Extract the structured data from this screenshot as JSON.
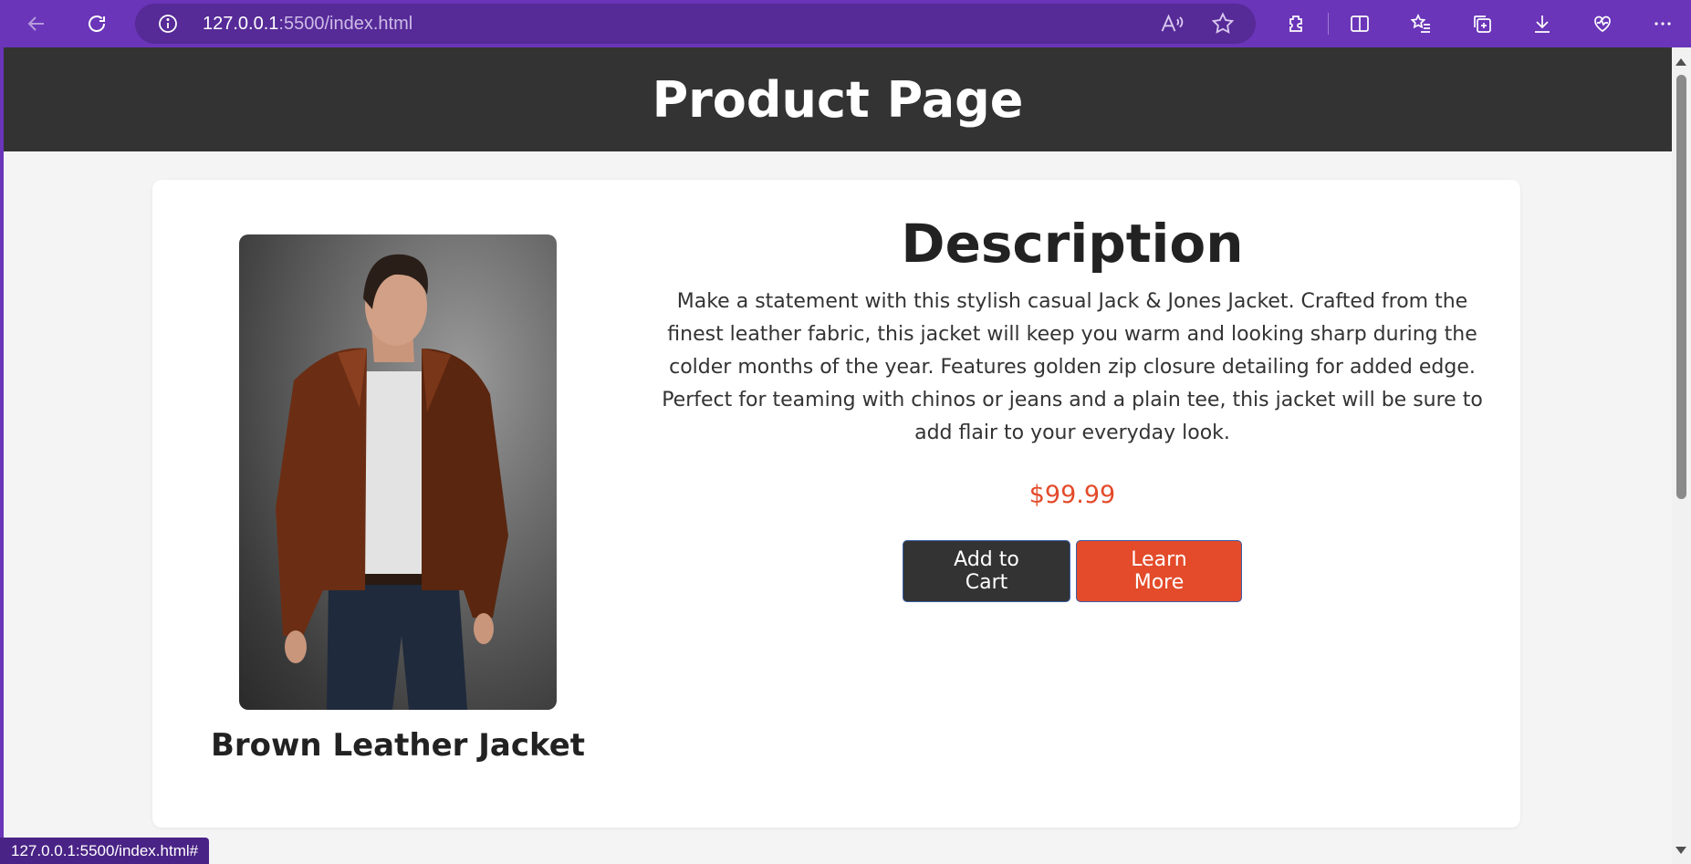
{
  "browser": {
    "url_host": "127.0.0.1",
    "url_rest": ":5500/index.html",
    "status_url": "127.0.0.1:5500/index.html#",
    "icons": [
      "back-icon",
      "refresh-icon",
      "info-icon",
      "read-aloud-icon",
      "favorite-star-icon",
      "extensions-icon",
      "split-screen-icon",
      "favorites-icon",
      "collections-icon",
      "downloads-icon",
      "browser-essentials-icon",
      "more-icon"
    ]
  },
  "page": {
    "title": "Product Page",
    "product": {
      "name": "Brown Leather Jacket",
      "description_title": "Description",
      "description": "Make a statement with this stylish casual Jack & Jones Jacket. Crafted from the finest leather fabric, this jacket will keep you warm and looking sharp during the colder months of the year. Features golden zip closure detailing for added edge. Perfect for teaming with chinos or jeans and a plain tee, this jacket will be sure to add flair to your everyday look.",
      "price": "$99.99",
      "add_to_cart_label": "Add to Cart",
      "learn_more_label": "Learn More"
    }
  },
  "colors": {
    "browser_frame": "#6a35b8",
    "header_bg": "#333333",
    "accent": "#e34b2a",
    "page_bg": "#f4f4f4"
  }
}
